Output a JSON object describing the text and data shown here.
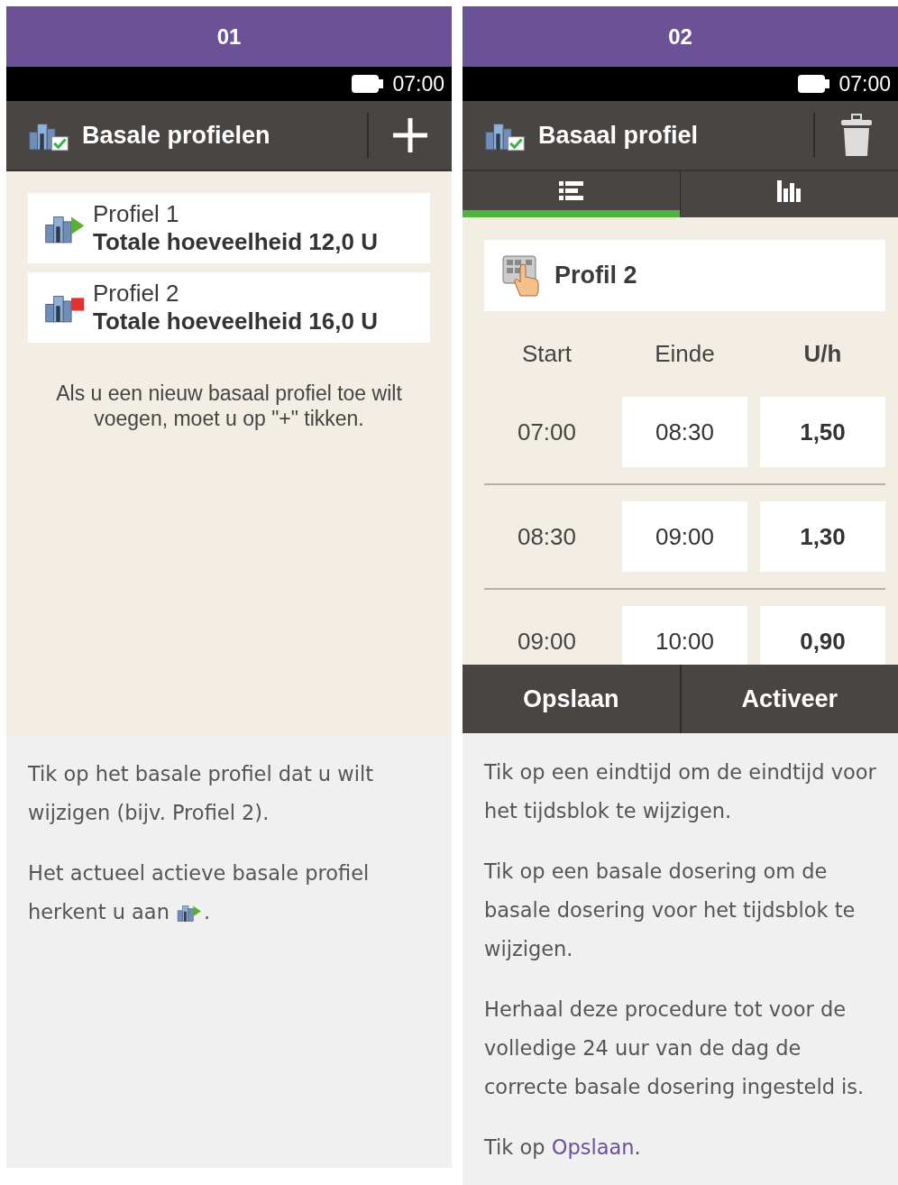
{
  "panels": [
    {
      "step": "01",
      "status_time": "07:00",
      "title": "Basale profielen",
      "profiles": [
        {
          "name": "Profiel 1",
          "total": "Totale hoeveelheid 12,0 U",
          "active": true
        },
        {
          "name": "Profiel 2",
          "total": "Totale hoeveelheid 16,0 U",
          "active": false
        }
      ],
      "hint": "Als u een nieuw basaal profiel toe wilt voegen, moet u op \"+\" tikken.",
      "instructions": [
        {
          "kind": "text",
          "text": "Tik op het basale profiel dat u wilt wijzigen (bijv. Profiel 2)."
        },
        {
          "kind": "icon",
          "lines": [
            "Het actueel actieve basale profiel",
            "herkent u aan"
          ],
          "after": "."
        }
      ]
    },
    {
      "step": "02",
      "status_time": "07:00",
      "title": "Basaal profiel",
      "tabs": [
        {
          "kind": "list",
          "selected": true
        },
        {
          "kind": "chart",
          "selected": false
        }
      ],
      "profile_name": "Profil 2",
      "columns": [
        "Start",
        "Einde",
        "U/h"
      ],
      "rows": [
        {
          "start": "07:00",
          "end": "08:30",
          "rate": "1,50"
        },
        {
          "start": "08:30",
          "end": "09:00",
          "rate": "1,30"
        },
        {
          "start": "09:00",
          "end": "10:00",
          "rate": "0,90"
        }
      ],
      "buttons": [
        "Opslaan",
        "Activeer"
      ],
      "instructions": [
        {
          "kind": "text",
          "text": "Tik op een eindtijd om de eindtijd voor het tijdsblok te wijzigen."
        },
        {
          "kind": "text",
          "text": "Tik op een basale dosering om de basale dosering voor het tijdsblok te wijzigen."
        },
        {
          "kind": "text",
          "text": "Herhaal deze procedure tot voor de volledige 24 uur van de dag de correcte basale dosering ingesteld is."
        },
        {
          "kind": "link",
          "text": "Tik op ",
          "link": "Opslaan",
          "after": "."
        }
      ]
    }
  ]
}
